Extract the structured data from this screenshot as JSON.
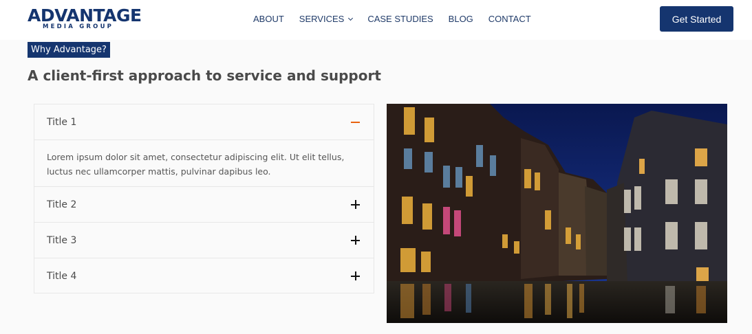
{
  "header": {
    "logo": {
      "main": "ADVANTAGE",
      "sub": "MEDIA GROUP"
    },
    "nav": [
      {
        "label": "ABOUT"
      },
      {
        "label": "SERVICES",
        "has_dropdown": true
      },
      {
        "label": "CASE STUDIES"
      },
      {
        "label": "BLOG"
      },
      {
        "label": "CONTACT"
      }
    ],
    "cta_label": "Get Started"
  },
  "section": {
    "eyebrow": "Why Advantage?",
    "heading": "A client-first approach to service and support"
  },
  "accordion": {
    "items": [
      {
        "title": "Title 1",
        "expanded": true,
        "icon": "minus-icon",
        "body": "Lorem ipsum dolor sit amet, consectetur adipiscing elit. Ut elit tellus, luctus nec ullamcorper mattis, pulvinar dapibus leo."
      },
      {
        "title": "Title 2",
        "expanded": false,
        "icon": "plus-icon"
      },
      {
        "title": "Title 3",
        "expanded": false,
        "icon": "plus-icon"
      },
      {
        "title": "Title 4",
        "expanded": false,
        "icon": "plus-icon"
      }
    ]
  },
  "image": {
    "subject": "canal-houses-night-photo"
  },
  "colors": {
    "brand": "#15356f",
    "accent": "#e8620f",
    "page_bg": "#fafafa"
  }
}
